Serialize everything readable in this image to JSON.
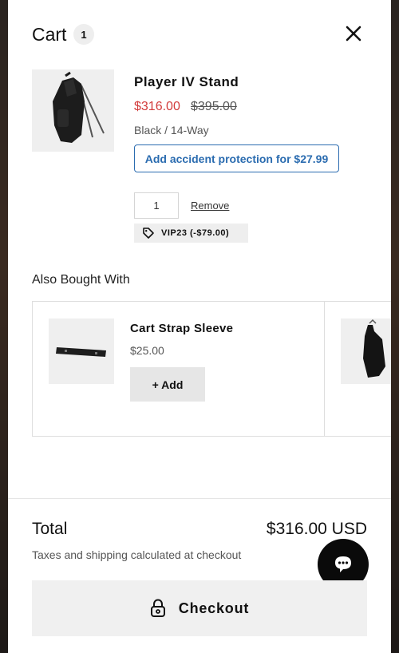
{
  "header": {
    "title": "Cart",
    "count": "1"
  },
  "line_item": {
    "name": "Player IV Stand",
    "sale_price": "$316.00",
    "original_price": "$395.00",
    "variant": "Black / 14-Way",
    "protection_label": "Add accident protection for $27.99",
    "quantity": "1",
    "remove_label": "Remove",
    "discount_code": "VIP23 (-$79.00)"
  },
  "also_bought": {
    "title": "Also Bought With",
    "items": [
      {
        "name": "Cart Strap Sleeve",
        "price": "$25.00",
        "add_label": "+ Add"
      }
    ]
  },
  "footer": {
    "total_label": "Total",
    "total_value": "$316.00 USD",
    "tax_note": "Taxes and shipping calculated at checkout",
    "checkout_label": "Checkout"
  },
  "colors": {
    "sale": "#d23b3b",
    "link_blue": "#2b6cb0",
    "chat_button": "#0a0a0a"
  },
  "icons": [
    "close-icon",
    "tag-icon",
    "lock-icon",
    "chat-icon"
  ]
}
